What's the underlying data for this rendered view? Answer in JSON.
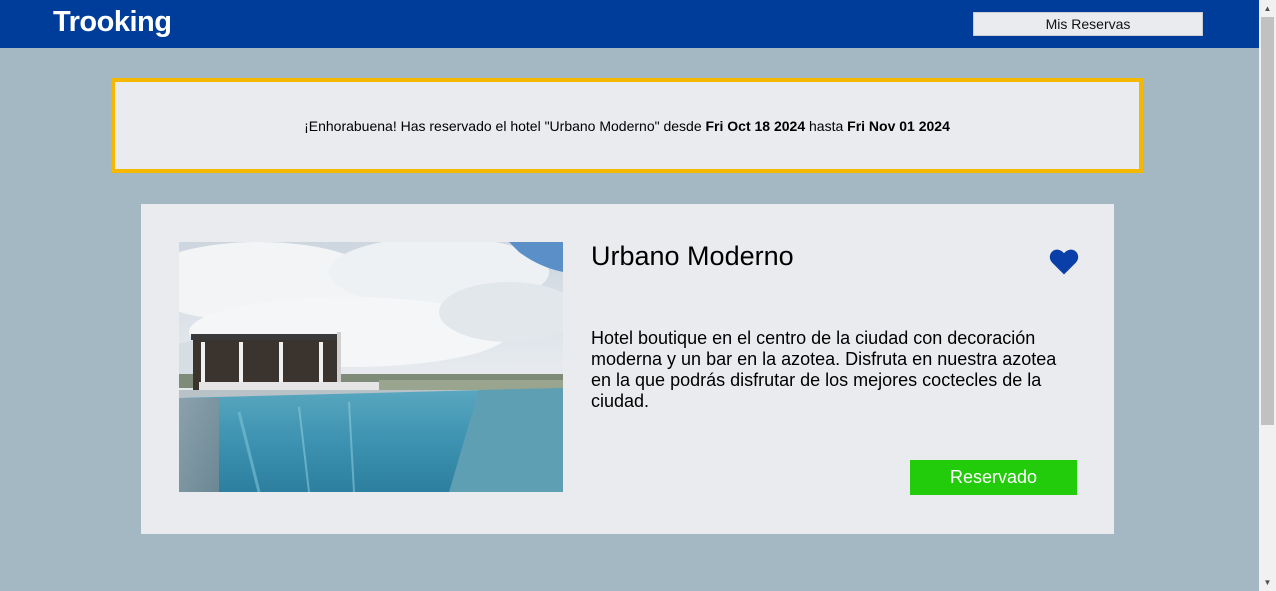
{
  "header": {
    "brand": "Trooking",
    "my_bookings_label": "Mis Reservas"
  },
  "alert": {
    "prefix": "¡Enhorabuena! Has reservado el hotel \"Urbano Moderno\" desde ",
    "start_date": "Fri Oct 18 2024",
    "middle": " hasta ",
    "end_date": "Fri Nov 01 2024"
  },
  "hotel": {
    "name": "Urbano Moderno",
    "description": "Hotel boutique en el centro de la ciudad con decoración moderna y un bar en la azotea. Disfruta en nuestra azotea en la que podrás disfrutar de los mejores coctecles de la ciudad.",
    "button_label": "Reservado",
    "favorite_icon": "heart-icon",
    "image_alt": "rooftop-pool-photo"
  },
  "colors": {
    "header_bg": "#003c99",
    "page_bg": "#a3b8c2",
    "card_bg": "#e9ebee",
    "alert_border": "#f5b800",
    "button_green": "#22cc0a",
    "heart_blue": "#0a3ea8"
  }
}
